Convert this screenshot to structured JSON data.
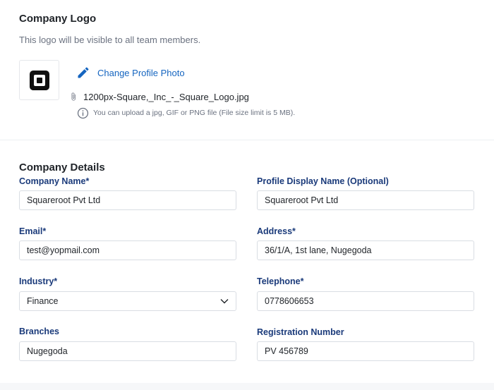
{
  "logo_section": {
    "title": "Company Logo",
    "subtitle": "This logo will be visible to all team members.",
    "change_photo_label": "Change Profile Photo",
    "file_name": "1200px-Square,_Inc_-_Square_Logo.jpg",
    "upload_hint": "You can upload a jpg, GIF or PNG file (File size limit is 5 MB)."
  },
  "details_section": {
    "title": "Company Details",
    "fields": {
      "company_name": {
        "label": "Company Name*",
        "value": "Squareroot Pvt Ltd"
      },
      "profile_display_name": {
        "label": "Profile Display Name (Optional)",
        "value": "Squareroot Pvt Ltd"
      },
      "email": {
        "label": "Email*",
        "value": "test@yopmail.com"
      },
      "address": {
        "label": "Address*",
        "value": "36/1/A, 1st lane, Nugegoda"
      },
      "industry": {
        "label": "Industry*",
        "value": "Finance"
      },
      "telephone": {
        "label": "Telephone*",
        "value": "0778606653"
      },
      "branches": {
        "label": "Branches",
        "value": "Nugegoda"
      },
      "registration_number": {
        "label": "Registration Number",
        "value": "PV 456789"
      }
    }
  },
  "icons": {
    "logo": "square-logo-icon",
    "edit": "pencil-icon",
    "attachment": "paperclip-icon",
    "info": "info-icon",
    "dropdown": "chevron-down-icon"
  },
  "colors": {
    "link": "#1565c0",
    "label": "#1a3a7a",
    "border": "#d9dde3"
  }
}
